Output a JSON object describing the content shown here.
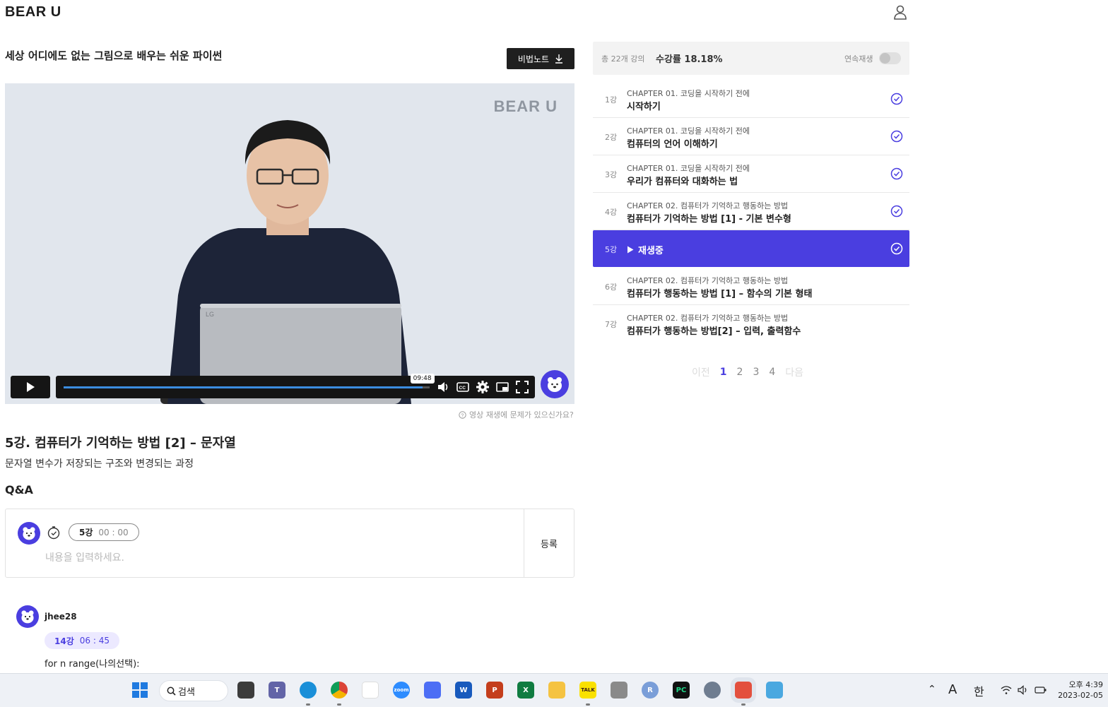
{
  "header": {
    "logo": "BEAR U",
    "user_icon": "user-icon"
  },
  "course": {
    "title": "세상 어디에도 없는 그림으로 배우는 쉬운 파이썬",
    "notes_button": "비법노트"
  },
  "player": {
    "watermark": "BEAR U",
    "progress": 0.98,
    "time_tooltip": "09:48"
  },
  "report_link": "영상 재생에 문제가 있으신가요?",
  "lecture": {
    "title": "5강. 컴퓨터가 기억하는 방법 [2] – 문자열",
    "description": "문자열 변수가 저장되는 구조와 변경되는 과정"
  },
  "qa": {
    "heading": "Q&A",
    "stamp_lesson": "5강",
    "stamp_time": "00 : 00",
    "placeholder": "내용을 입력하세요.",
    "submit": "등록"
  },
  "comment": {
    "user": "jhee28",
    "stamp_lesson": "14강",
    "stamp_time": "06 : 45",
    "text": "for n range(나의선택):"
  },
  "sidebar": {
    "total": "총 22개 강의",
    "rate": "수강률 18.18%",
    "autoplay_label": "연속재생",
    "autoplay_on": false,
    "lessons": [
      {
        "num": "1강",
        "chapter": "CHAPTER 01. 코딩을 시작하기 전에",
        "title": "시작하기"
      },
      {
        "num": "2강",
        "chapter": "CHAPTER 01. 코딩을 시작하기 전에",
        "title": "컴퓨터의 언어 이해하기"
      },
      {
        "num": "3강",
        "chapter": "CHAPTER 01. 코딩을 시작하기 전에",
        "title": "우리가 컴퓨터와 대화하는 법"
      },
      {
        "num": "4강",
        "chapter": "CHAPTER 02. 컴퓨터가 기억하고 행동하는 방법",
        "title": "컴퓨터가 기억하는 방법 [1] - 기본 변수형"
      },
      {
        "num": "5강",
        "now_playing": "재생중"
      },
      {
        "num": "6강",
        "chapter": "CHAPTER 02. 컴퓨터가 기억하고 행동하는 방법",
        "title": "컴퓨터가 행동하는 방법 [1] – 함수의 기본 형태"
      },
      {
        "num": "7강",
        "chapter": "CHAPTER 02. 컴퓨터가 기억하고 행동하는 방법",
        "title": "컴퓨터가 행동하는 방법[2] – 입력, 출력함수"
      }
    ],
    "pager": {
      "prev": "이전",
      "pages": [
        "1",
        "2",
        "3",
        "4"
      ],
      "next": "다음",
      "current": "1"
    }
  },
  "taskbar": {
    "search": "검색",
    "ime_a": "A",
    "ime_han": "한",
    "time": "오후 4:39",
    "date": "2023-02-05",
    "apps": [
      "task-view",
      "teams",
      "edge",
      "chrome",
      "app-5",
      "zoom",
      "calculator",
      "word",
      "powerpoint",
      "excel",
      "file-explorer",
      "kakaotalk",
      "recorder",
      "r",
      "pycharm",
      "settings",
      "snipping-tool",
      "notepad"
    ]
  },
  "colors": {
    "accent": "#4a3ee0",
    "dark": "#1f1f1f"
  }
}
